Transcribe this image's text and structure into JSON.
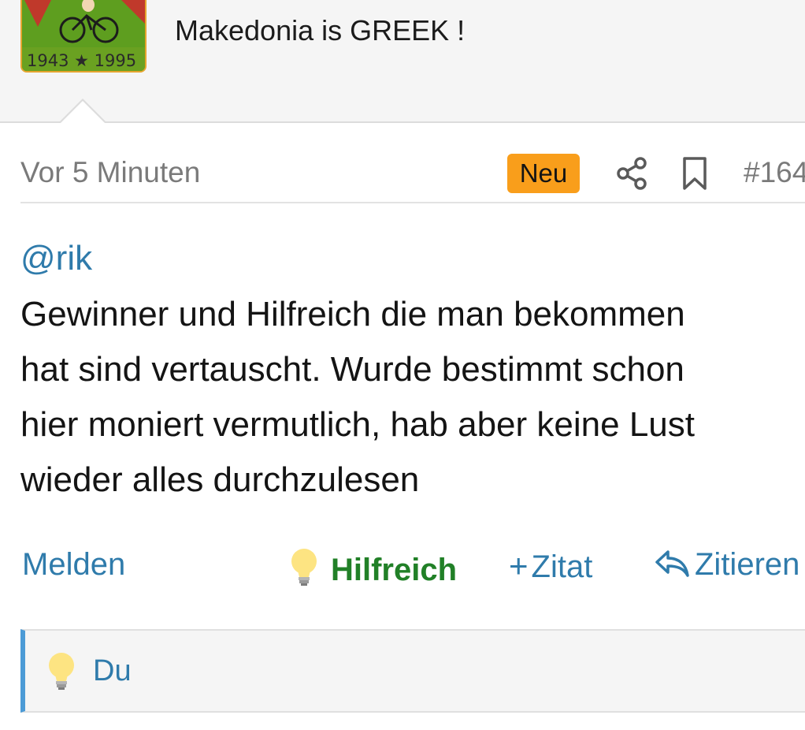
{
  "user": {
    "avatar_years": "1943 ★ 1995",
    "signature": "Makedonia is GREEK !"
  },
  "post": {
    "time": "Vor 5 Minuten",
    "badge": "Neu",
    "number": "#164",
    "mention": "@rik",
    "text": "Gewinner und Hilfreich die man bekommen\nhat sind vertauscht. Wurde bestimmt schon\nhier moniert vermutlich, hab aber keine Lust\nwieder alles durchzulesen"
  },
  "actions": {
    "report": "Melden",
    "helpful": "Hilfreich",
    "quote": "Zitat",
    "reply": "Zitieren"
  },
  "reactions": {
    "user": "Du"
  },
  "colors": {
    "link": "#2f7bab",
    "helpful": "#218027",
    "badge": "#f99e1b",
    "accent_bar": "#4c9bd6"
  }
}
